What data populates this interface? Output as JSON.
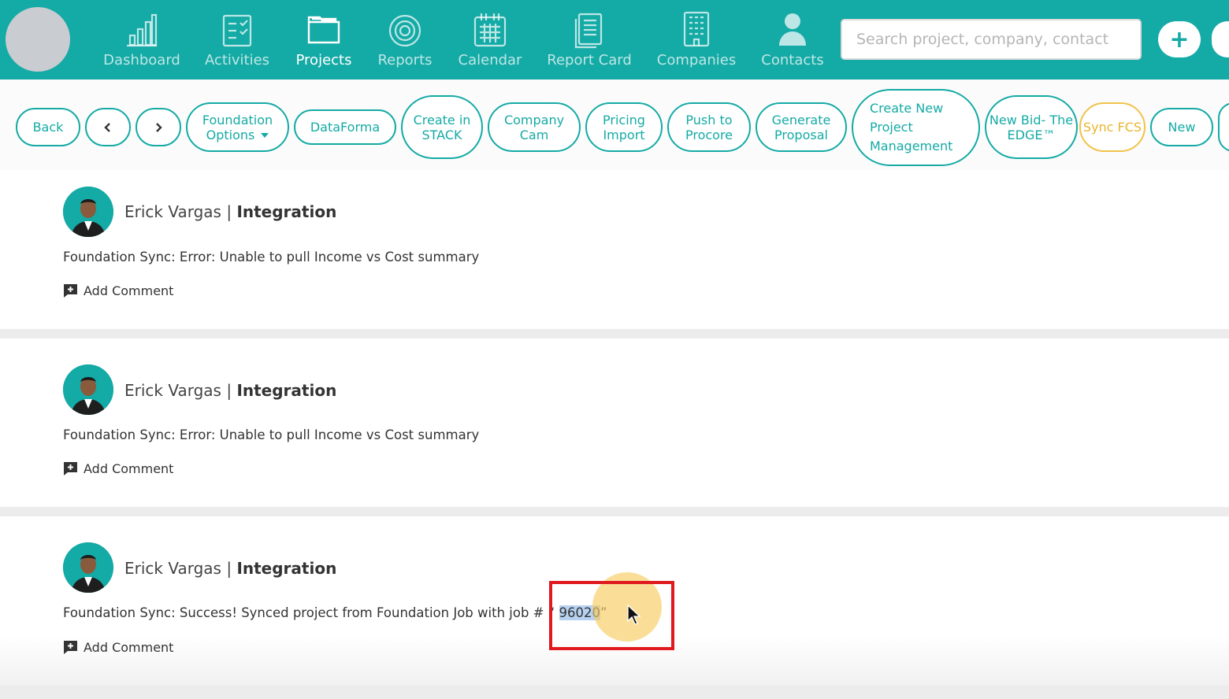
{
  "nav": {
    "items": [
      {
        "label": "Dashboard",
        "icon": "bar-chart-icon"
      },
      {
        "label": "Activities",
        "icon": "checklist-icon"
      },
      {
        "label": "Projects",
        "icon": "folder-icon",
        "active": true
      },
      {
        "label": "Reports",
        "icon": "target-icon"
      },
      {
        "label": "Calendar",
        "icon": "calendar-icon"
      },
      {
        "label": "Report Card",
        "icon": "document-icon"
      },
      {
        "label": "Companies",
        "icon": "building-icon"
      },
      {
        "label": "Contacts",
        "icon": "person-icon"
      }
    ],
    "search_placeholder": "Search project, company, contact",
    "add_label": "+"
  },
  "toolbar": {
    "back": "Back",
    "foundation_options": "Foundation Options",
    "dataforma": "DataForma",
    "create_in_stack": "Create in STACK",
    "company_cam": "Company Cam",
    "pricing_import": "Pricing Import",
    "push_to_procore": "Push to Procore",
    "generate_proposal": "Generate Proposal",
    "create_new_pm": "Create New Project Management",
    "new_bid": "New Bid- The EDGE™",
    "sync_fcs": "Sync FCS",
    "new": "New"
  },
  "feed": [
    {
      "author": "Erick Vargas",
      "role": "Integration",
      "message": "Foundation Sync: Error: Unable to pull Income vs Cost summary",
      "comment_label": "Add Comment"
    },
    {
      "author": "Erick Vargas",
      "role": "Integration",
      "message": "Foundation Sync: Error: Unable to pull Income vs Cost summary",
      "comment_label": "Add Comment"
    },
    {
      "author": "Erick Vargas",
      "role": "Integration",
      "message_prefix": "Foundation Sync: Success! Synced project from Foundation Job with job # “ ",
      "message_selected": "96020",
      "message_suffix": "”",
      "comment_label": "Add Comment"
    }
  ],
  "colors": {
    "accent": "#14aaa5",
    "sync": "#f1c24a",
    "highlight_box": "#e0191f"
  }
}
